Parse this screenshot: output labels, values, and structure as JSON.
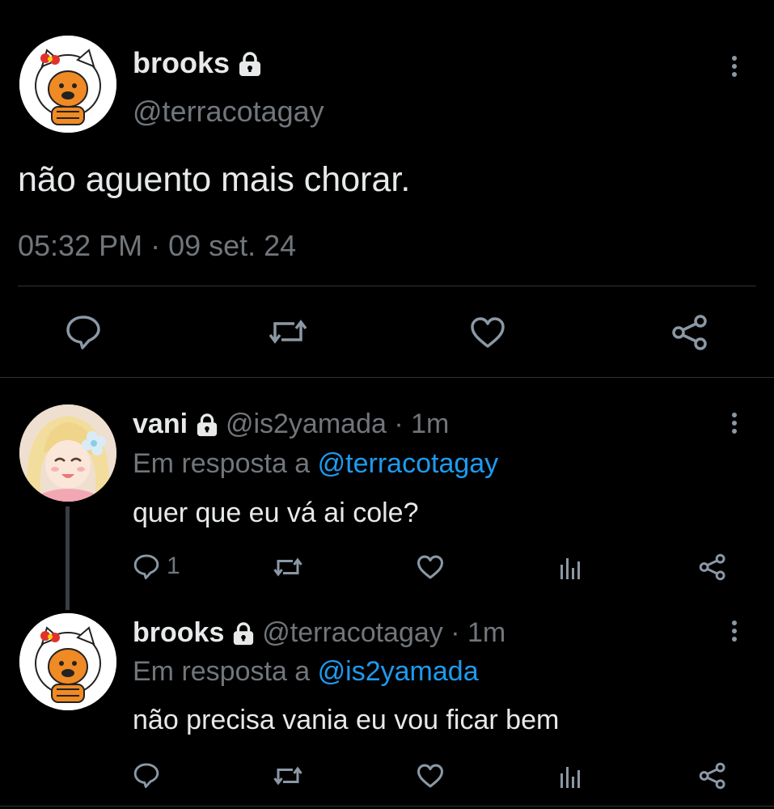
{
  "main_tweet": {
    "name": "brooks",
    "handle": "@terracotagay",
    "text": "não aguento mais chorar.",
    "timestamp": "05:32 PM · 09 set. 24"
  },
  "replies": [
    {
      "name": "vani",
      "handle": "@is2yamada",
      "time": "· 1m",
      "reply_prefix": "Em resposta a",
      "reply_to": "@terracotagay",
      "text": "quer que eu vá ai cole?",
      "reply_count": "1"
    },
    {
      "name": "brooks",
      "handle": "@terracotagay",
      "time": "· 1m",
      "reply_prefix": "Em resposta a",
      "reply_to": "@is2yamada",
      "text": "não precisa vania eu vou ficar bem",
      "reply_count": ""
    }
  ],
  "colors": {
    "background": "#000000",
    "text": "#e7e9ea",
    "muted": "#71767b",
    "link": "#1d9bf0",
    "divider": "#2f3336"
  }
}
